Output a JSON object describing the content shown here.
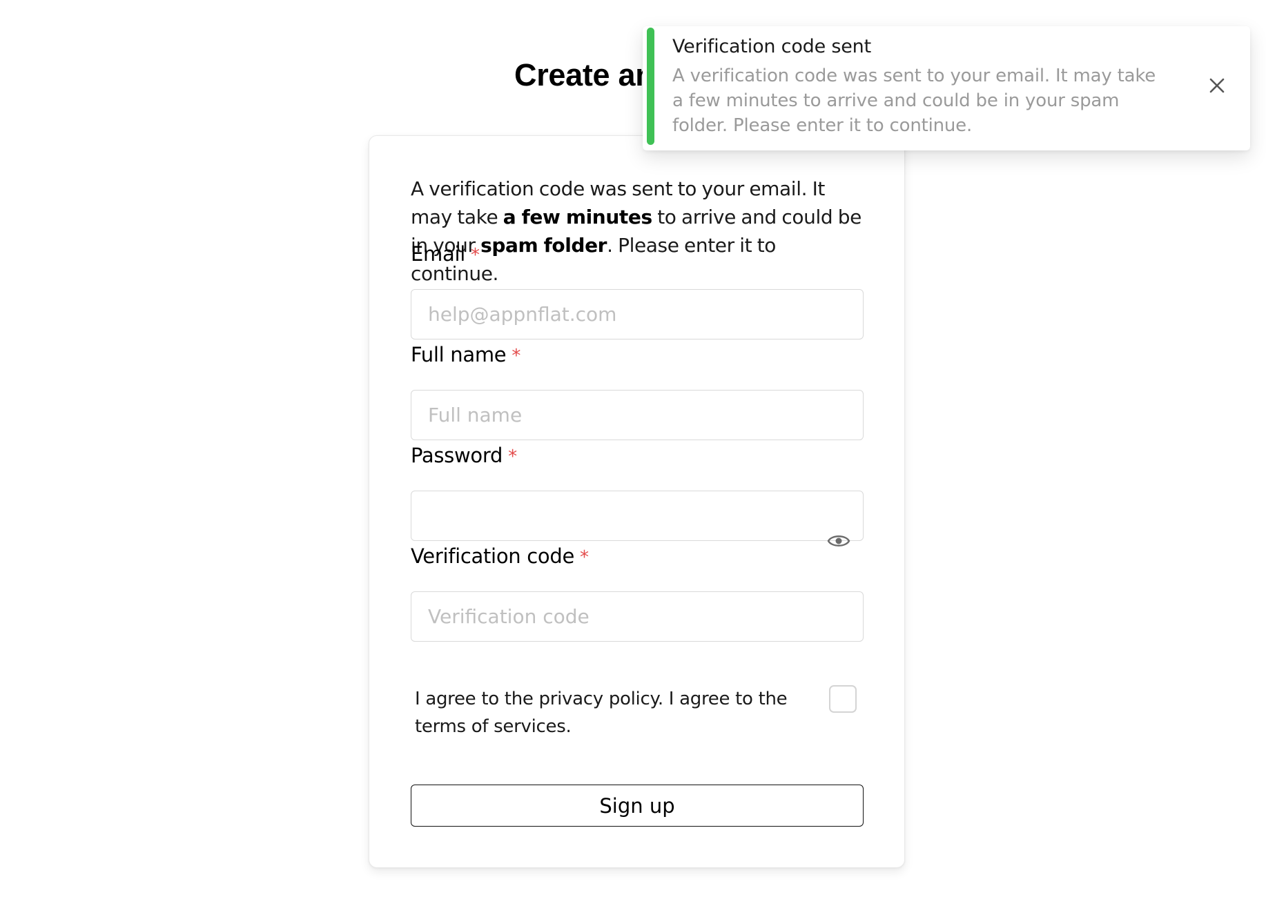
{
  "page": {
    "title": "Create an"
  },
  "form": {
    "intro": {
      "part1": "A verification code was sent to your email. It may take ",
      "bold1": "a few minutes",
      "part2": " to arrive and could be in your ",
      "bold2": "spam folder",
      "part3": ". Please enter it to continue."
    },
    "required_mark": "*",
    "email": {
      "label": "Email",
      "placeholder": "help@appnflat.com",
      "value": ""
    },
    "full_name": {
      "label": "Full name",
      "placeholder": "Full name",
      "value": ""
    },
    "password": {
      "label": "Password",
      "placeholder": "",
      "value": "",
      "toggle_icon": "eye-icon"
    },
    "verification_code": {
      "label": "Verification code",
      "placeholder": "Verification code",
      "value": ""
    },
    "agreement": {
      "text": "I agree to the privacy policy. I agree to the terms of services.",
      "checked": false
    },
    "submit_label": "Sign up"
  },
  "toast": {
    "title": "Verification code sent",
    "message": "A verification code was sent to your email. It may take a few minutes to arrive and could be in your spam folder. Please enter it to continue.",
    "accent_color": "#3fc155",
    "close_icon": "close-icon"
  }
}
